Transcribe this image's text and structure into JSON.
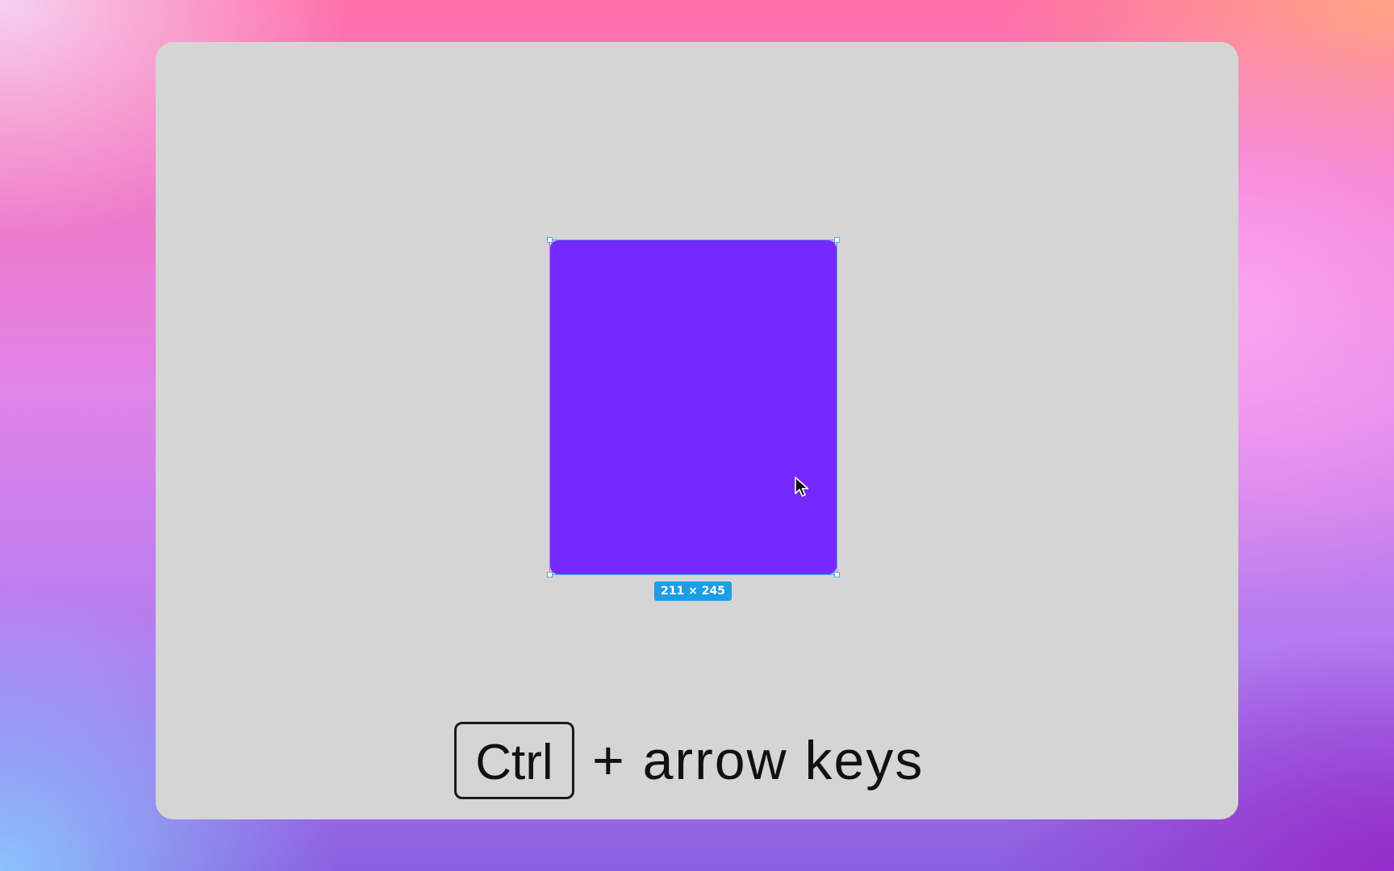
{
  "canvas": {
    "background": "#d5d5d5"
  },
  "shape": {
    "fill": "#7629ff",
    "selection_color": "#4aa6e8",
    "dimensions_label": "211 × 245",
    "badge_color": "#1e9de5"
  },
  "cursor": {
    "icon": "arrow-pointer-icon"
  },
  "shortcut": {
    "key_label": "Ctrl",
    "rest_label": "+ arrow keys"
  }
}
